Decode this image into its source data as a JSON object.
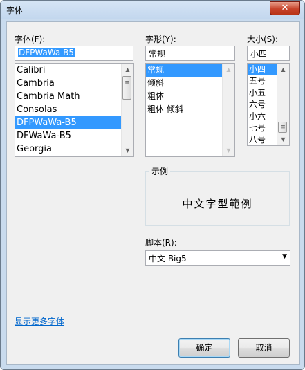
{
  "window": {
    "title": "字体",
    "close_glyph": "✕"
  },
  "font": {
    "label": "字体(F):",
    "value": "DFPWaWa-B5",
    "items": [
      "Calibri",
      "Cambria",
      "Cambria Math",
      "Consolas",
      "DFPWaWa-B5",
      "DFWaWa-B5",
      "Georgia"
    ],
    "selected_index": 4
  },
  "style": {
    "label": "字形(Y):",
    "value": "常规",
    "items": [
      "常规",
      "倾斜",
      "粗体",
      "粗体 倾斜"
    ],
    "selected_index": 0
  },
  "size": {
    "label": "大小(S):",
    "value": "小四",
    "items": [
      "小四",
      "五号",
      "小五",
      "六号",
      "小六",
      "七号",
      "八号"
    ],
    "selected_index": 0
  },
  "sample": {
    "label": "示例",
    "text": "中文字型範例"
  },
  "script": {
    "label": "脚本(R):",
    "value": "中文 Big5"
  },
  "more_fonts_link": "显示更多字体",
  "buttons": {
    "ok": "确定",
    "cancel": "取消"
  },
  "colors": {
    "selection": "#3399ff",
    "link": "#0066cc",
    "close_button": "#c7432a"
  }
}
